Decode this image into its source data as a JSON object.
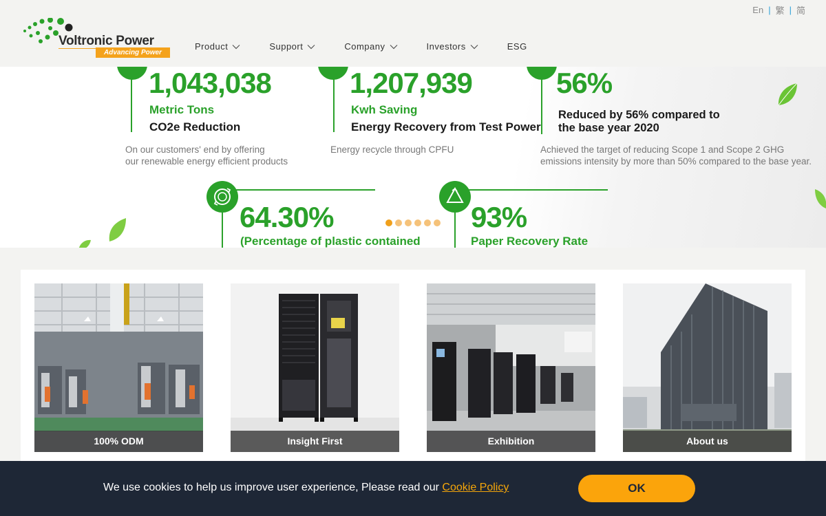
{
  "header": {
    "languages": [
      "En",
      "繁",
      "简"
    ],
    "logo": {
      "brand": "Voltronic Power",
      "tagline": "Advancing Power"
    },
    "nav": [
      {
        "label": "Product",
        "has_dropdown": true
      },
      {
        "label": "Support",
        "has_dropdown": true
      },
      {
        "label": "Company",
        "has_dropdown": true
      },
      {
        "label": "Investors",
        "has_dropdown": true
      },
      {
        "label": "ESG",
        "has_dropdown": false
      }
    ]
  },
  "banner": {
    "stats": [
      {
        "value": "1,043,038",
        "green_label": "Metric Tons",
        "black_label": "CO2e Reduction",
        "desc": [
          "On our customers' end by offering",
          "our renewable energy efficient products"
        ]
      },
      {
        "value": "1,207,939",
        "green_label": "Kwh Saving",
        "black_label": "Energy Recovery from Test Power",
        "desc": [
          "Energy recycle through CPFU"
        ]
      },
      {
        "value": "56%",
        "green_label": "",
        "black_label_lines": [
          "Reduced by 56% compared to",
          "the base year 2020"
        ],
        "desc": [
          "Achieved the target of reducing Scope 1 and Scope 2 GHG",
          "emissions intensity by more than 50% compared to the base year."
        ]
      },
      {
        "value": "64.30%",
        "green_label": "(Percentage of plastic contained"
      },
      {
        "value": "93%",
        "green_label": "Paper Recovery Rate"
      }
    ],
    "slider": {
      "total": 6,
      "active": 1
    }
  },
  "cards": [
    {
      "caption": "100% ODM"
    },
    {
      "caption": "Insight First"
    },
    {
      "caption": "Exhibition"
    },
    {
      "caption": "About us"
    }
  ],
  "cookie": {
    "message": "We use cookies to help us improve user experience, Please read our ",
    "link": "Cookie Policy",
    "button": "OK"
  },
  "colors": {
    "green": "#2aa12a",
    "orange": "#fba40b",
    "cookie_bg": "#1e2736"
  }
}
